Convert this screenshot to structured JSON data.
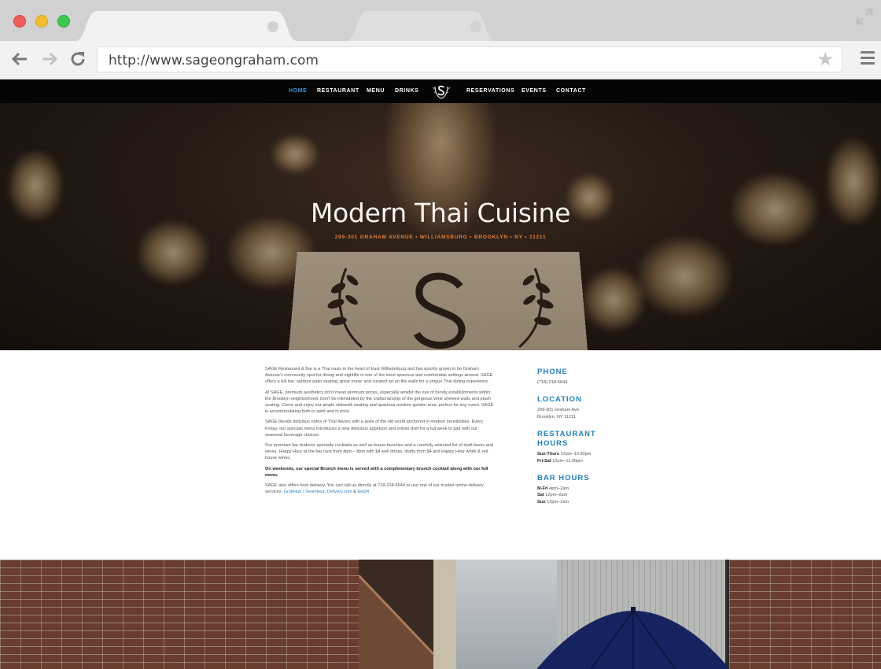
{
  "browser": {
    "url": "http://www.sageongraham.com"
  },
  "nav": {
    "items": [
      "HOME",
      "RESTAURANT",
      "MENU",
      "DRINKS",
      "RESERVATIONS",
      "EVENTS",
      "CONTACT"
    ],
    "active": "HOME"
  },
  "hero": {
    "title": "Modern Thai Cuisine",
    "subtitle": "299-301 GRAHAM AVENUE • WILLIAMSBURG • BROOKLYN • NY • 11211"
  },
  "intro": {
    "p1": "SAGE Restaurant & Bar is a Thai oasis in the heart of East Williamsburg and has quickly grown to be Graham Avenue's community spot for dining and nightlife in one of the most spacious and comfortable settings around. SAGE offers a full bar, outdoor patio seating, great music and curated art on the walls for a unique Thai dining experience.",
    "p2": "At SAGE, premium aesthetics don't mean premium prices, especially amidst the rise of trendy establishments within the Brooklyn neighborhood. Don't be intimidated by the craftsmanship of the gorgeous wine shelved-walls and plush seating. Come and enjoy our ample sidewalk seating and spacious outdoor garden area, perfect for any event. SAGE is accommodating both in spirit and in price.",
    "p3": "SAGE blends delicious notes of Thai flavors with a taste of the old world anchored in modern sensibilities. Every Friday, our specials menu introduces a new delicious appetizer and entrée dish for a full week to pair with our seasonal beverage choices.",
    "p4": "Our premium bar features specialty cocktails as well as house favorites and a carefully selected list of draft beers and wines. Happy Hour at the bar runs from 4pm – 8pm with $4 well drinks, drafts from $4 and Happy Hour white & red house wines.",
    "p5": "On weekends, our special Brunch menu is served with a complimentary brunch cocktail along with our full menu.",
    "p6_text": "SAGE also offers food delivery.  You can call us directly at 718-218-6644 or use one of our trusted online delivery services: ",
    "p6_links": [
      "GrubHub",
      "Seamless",
      "Delivery.com",
      "Eat24"
    ],
    "p6_sep1": " / ",
    "p6_sep2": ", ",
    "p6_sep3": " & "
  },
  "info": {
    "phone": {
      "heading": "PHONE",
      "value": "(718) 218-6644"
    },
    "location": {
      "heading": "LOCATION",
      "line1": "299-301 Graham Ave",
      "line2": "Brooklyn, NY 11211"
    },
    "restaurant_hours": {
      "heading_line1": "RESTAURANT",
      "heading_line2": "HOURS",
      "rows": [
        {
          "days": "Sun-Thurs",
          "hours": "12pm–10:30pm"
        },
        {
          "days": "Fri-Sat",
          "hours": "12pm–11:30pm"
        }
      ]
    },
    "bar_hours": {
      "heading": "BAR HOURS",
      "rows": [
        {
          "days": "M-Fri",
          "hours": "4pm–2am"
        },
        {
          "days": "Sat",
          "hours": "12pm–2am"
        },
        {
          "days": "Sun",
          "hours": "12pm–2am"
        }
      ]
    }
  },
  "colors": {
    "accent_blue": "#1f7fc1",
    "nav_active": "#3b94d9",
    "subtitle_orange": "#e8833a",
    "nav_bg": "#050505"
  },
  "icons": [
    "back-arrow-icon",
    "forward-arrow-icon",
    "reload-icon",
    "star-icon",
    "menu-icon",
    "expand-icon",
    "sage-logo-icon"
  ]
}
